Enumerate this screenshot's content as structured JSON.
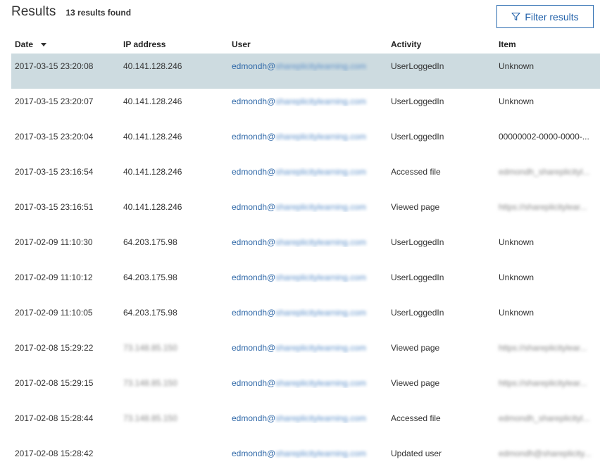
{
  "header": {
    "title": "Results",
    "count": "13 results found",
    "filter_label": "Filter results"
  },
  "columns": [
    "Date",
    "IP address",
    "User",
    "Activity",
    "Item"
  ],
  "rows": [
    {
      "date": "2017-03-15 23:20:08",
      "ip": "40.141.128.246",
      "user_prefix": "edmondh@",
      "user_domain": "shareplicitylearning.com",
      "activity": "UserLoggedIn",
      "item": "Unknown",
      "selected": true
    },
    {
      "date": "2017-03-15 23:20:07",
      "ip": "40.141.128.246",
      "user_prefix": "edmondh@",
      "user_domain": "shareplicitylearning.com",
      "activity": "UserLoggedIn",
      "item": "Unknown"
    },
    {
      "date": "2017-03-15 23:20:04",
      "ip": "40.141.128.246",
      "user_prefix": "edmondh@",
      "user_domain": "shareplicitylearning.com",
      "activity": "UserLoggedIn",
      "item": "00000002-0000-0000-..."
    },
    {
      "date": "2017-03-15 23:16:54",
      "ip": "40.141.128.246",
      "user_prefix": "edmondh@",
      "user_domain": "shareplicitylearning.com",
      "activity": "Accessed file",
      "item": "edmondh_shareplicityl...",
      "item_blur": true
    },
    {
      "date": "2017-03-15 23:16:51",
      "ip": "40.141.128.246",
      "user_prefix": "edmondh@",
      "user_domain": "shareplicitylearning.com",
      "activity": "Viewed page",
      "item": "https://shareplicitylear...",
      "item_blur": true
    },
    {
      "date": "2017-02-09 11:10:30",
      "ip": "64.203.175.98",
      "user_prefix": "edmondh@",
      "user_domain": "shareplicitylearning.com",
      "activity": "UserLoggedIn",
      "item": "Unknown"
    },
    {
      "date": "2017-02-09 11:10:12",
      "ip": "64.203.175.98",
      "user_prefix": "edmondh@",
      "user_domain": "shareplicitylearning.com",
      "activity": "UserLoggedIn",
      "item": "Unknown"
    },
    {
      "date": "2017-02-09 11:10:05",
      "ip": "64.203.175.98",
      "user_prefix": "edmondh@",
      "user_domain": "shareplicitylearning.com",
      "activity": "UserLoggedIn",
      "item": "Unknown"
    },
    {
      "date": "2017-02-08 15:29:22",
      "ip": "73.148.85.150",
      "ip_blur": true,
      "user_prefix": "edmondh@",
      "user_domain": "shareplicitylearning.com",
      "activity": "Viewed page",
      "item": "https://shareplicitylear...",
      "item_blur": true
    },
    {
      "date": "2017-02-08 15:29:15",
      "ip": "73.148.85.150",
      "ip_blur": true,
      "user_prefix": "edmondh@",
      "user_domain": "shareplicitylearning.com",
      "activity": "Viewed page",
      "item": "https://shareplicitylear...",
      "item_blur": true
    },
    {
      "date": "2017-02-08 15:28:44",
      "ip": "73.148.85.150",
      "ip_blur": true,
      "user_prefix": "edmondh@",
      "user_domain": "shareplicitylearning.com",
      "activity": "Accessed file",
      "item": "edmondh_shareplicityl...",
      "item_blur": true
    },
    {
      "date": "2017-02-08 15:28:42",
      "ip": "",
      "user_prefix": "edmondh@",
      "user_domain": "shareplicitylearning.com",
      "activity": "Updated user",
      "item": "edmondh@shareplicity...",
      "item_blur": true
    }
  ],
  "colors": {
    "selected_row": "#cddbe0",
    "link": "#2f68a8",
    "accent": "#1f5fa8"
  },
  "icons": {
    "filter": "funnel-icon",
    "sort": "caret-down-icon"
  }
}
